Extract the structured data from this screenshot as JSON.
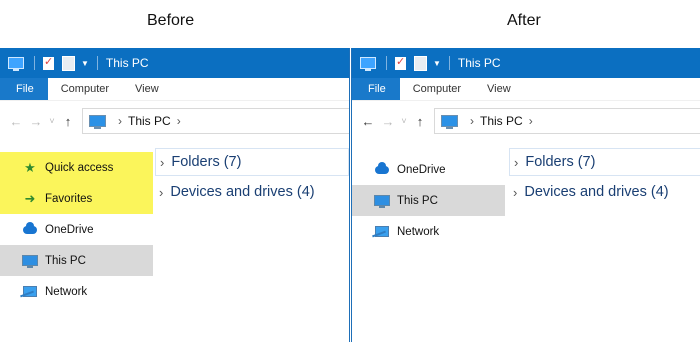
{
  "captions": {
    "before": "Before",
    "after": "After"
  },
  "window": {
    "title": "This PC",
    "ribbon_tabs": {
      "file": "File",
      "computer": "Computer",
      "view": "View"
    },
    "nav_glyphs": {
      "back": "←",
      "forward": "→",
      "recent": "˅",
      "up": "↑"
    },
    "address": {
      "location": "This PC",
      "separator": "›"
    }
  },
  "before": {
    "nav_items": [
      {
        "label": "Quick access",
        "icon": "star-icon",
        "state": "highlighted"
      },
      {
        "label": "Favorites",
        "icon": "favorites-arrow-icon",
        "state": "highlighted"
      },
      {
        "label": "OneDrive",
        "icon": "onedrive-cloud-icon",
        "state": "normal"
      },
      {
        "label": "This PC",
        "icon": "this-pc-icon",
        "state": "selected"
      },
      {
        "label": "Network",
        "icon": "network-icon",
        "state": "normal"
      }
    ]
  },
  "after": {
    "nav_items": [
      {
        "label": "OneDrive",
        "icon": "onedrive-cloud-icon",
        "state": "normal"
      },
      {
        "label": "This PC",
        "icon": "this-pc-icon",
        "state": "selected"
      },
      {
        "label": "Network",
        "icon": "network-icon",
        "state": "normal"
      }
    ]
  },
  "groups": [
    {
      "label": "Folders (7)"
    },
    {
      "label": "Devices and drives (4)"
    }
  ],
  "colors": {
    "titlebar": "#0b6fc1",
    "file_tab": "#1979ca",
    "highlight": "#fbf55b",
    "selected": "#d9d9d9",
    "group_text": "#1a3f73"
  }
}
